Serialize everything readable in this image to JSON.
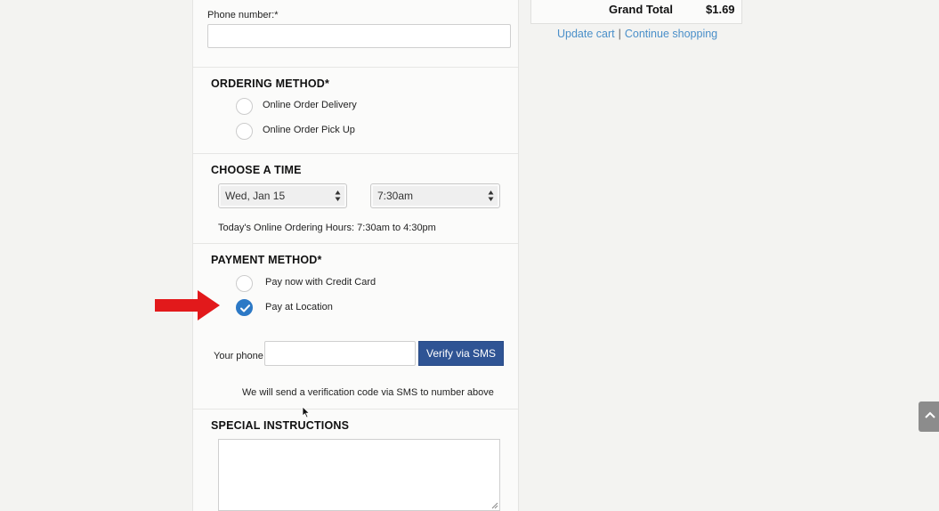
{
  "form": {
    "phone_label": "Phone number:*",
    "phone_value": "",
    "ordering": {
      "title": "ORDERING METHOD*",
      "options": [
        "Online Order Delivery",
        "Online Order Pick Up"
      ]
    },
    "time": {
      "title": "CHOOSE A TIME",
      "date_value": "Wed, Jan 15",
      "time_value": "7:30am",
      "hours_note": "Today's Online Ordering Hours: 7:30am to 4:30pm"
    },
    "payment": {
      "title": "PAYMENT METHOD*",
      "options": [
        "Pay now with Credit Card",
        "Pay at Location"
      ],
      "selected": "Pay at Location"
    },
    "verify": {
      "phone_label": "Your phone",
      "button_label": "Verify via SMS",
      "note": "We will send a verification code via SMS to number above"
    },
    "special": {
      "title": "SPECIAL INSTRUCTIONS"
    }
  },
  "cart": {
    "grand_total_label": "Grand Total",
    "grand_total_value": "$1.69",
    "update_link": "Update cart",
    "separator": "|",
    "continue_link": "Continue shopping"
  },
  "colors": {
    "accent": "#2c79c6",
    "button": "#2f5494",
    "link": "#4a8fc9",
    "arrow": "#e2191b"
  },
  "icons": {
    "annotation": "red-arrow-icon",
    "scroll_top": "chevron-up-icon",
    "cursor": "mouse-cursor-icon"
  }
}
